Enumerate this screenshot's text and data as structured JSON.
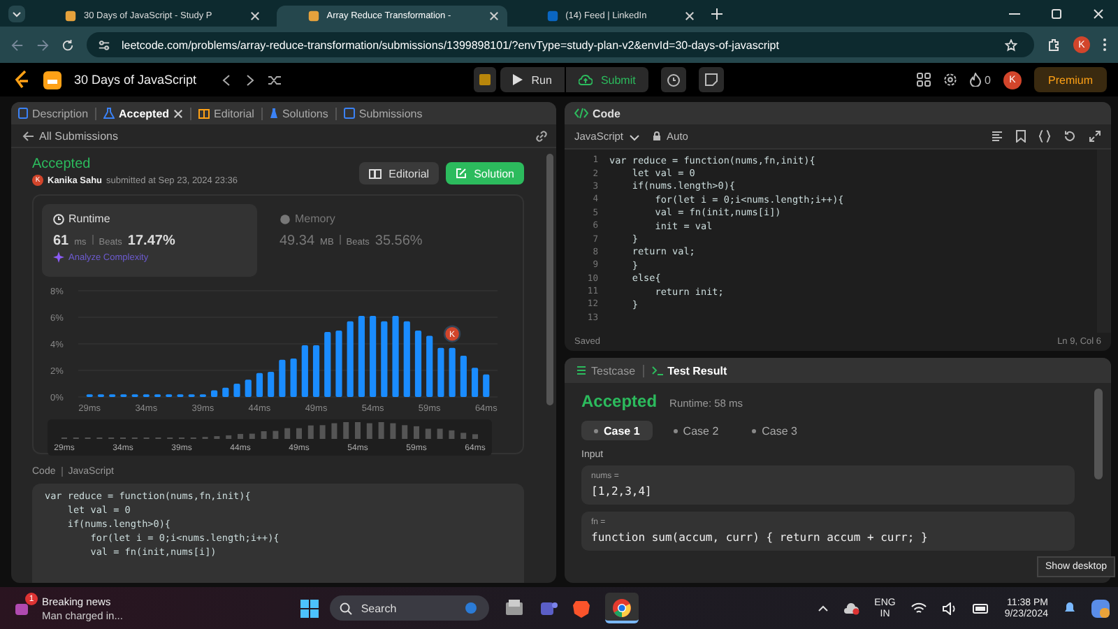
{
  "browser": {
    "tabs": [
      {
        "title": "30 Days of JavaScript - Study P",
        "selected": false
      },
      {
        "title": "Array Reduce Transformation - ",
        "selected": true
      },
      {
        "title": "(14) Feed | LinkedIn",
        "selected": false
      }
    ],
    "url": "leetcode.com/problems/array-reduce-transformation/submissions/1399898101/?envType=study-plan-v2&envId=30-days-of-javascript",
    "profile_initial": "K"
  },
  "nav": {
    "title": "30 Days of JavaScript",
    "run": "Run",
    "submit": "Submit",
    "streak": "0",
    "avatar_initial": "K",
    "premium": "Premium"
  },
  "left_panel": {
    "tabs": [
      {
        "label": "Description",
        "selected": false,
        "closable": false
      },
      {
        "label": "Accepted",
        "selected": true,
        "closable": true
      },
      {
        "label": "Editorial",
        "selected": false,
        "closable": false
      },
      {
        "label": "Solutions",
        "selected": false,
        "closable": false
      },
      {
        "label": "Submissions",
        "selected": false,
        "closable": false
      }
    ],
    "back_link": "All Submissions",
    "status": "Accepted",
    "author_initial": "K",
    "author": "Kanika Sahu",
    "submitted": "submitted at Sep 23, 2024 23:36",
    "buttons": [
      {
        "label": "Editorial",
        "kind": "secondary"
      },
      {
        "label": "Solution",
        "kind": "primary"
      }
    ],
    "stats": [
      {
        "kind": "runtime",
        "label": "Runtime",
        "value": "61",
        "unit": "ms",
        "beats_label": "Beats",
        "beats": "17.47%",
        "selected": true
      },
      {
        "kind": "memory",
        "label": "Memory",
        "value": "49.34",
        "unit": "MB",
        "beats_label": "Beats",
        "beats": "35.56%",
        "selected": false
      }
    ],
    "analyze_link": "Analyze Complexity",
    "chart_data": {
      "type": "bar",
      "x": [
        29,
        30,
        31,
        32,
        33,
        34,
        35,
        36,
        37,
        38,
        39,
        40,
        41,
        42,
        43,
        44,
        45,
        46,
        47,
        48,
        49,
        50,
        51,
        52,
        53,
        54,
        55,
        56,
        57,
        58,
        59,
        60,
        61,
        62,
        63,
        64
      ],
      "series": [
        {
          "color": "#1a8cff",
          "values": [
            0.2,
            0.2,
            0.2,
            0.2,
            0.2,
            0.2,
            0.2,
            0.2,
            0.2,
            0.2,
            0.2,
            0.5,
            0.7,
            1.0,
            1.3,
            1.8,
            1.9,
            2.8,
            2.9,
            3.9,
            3.9,
            4.9,
            5.0,
            5.7,
            6.1,
            6.1,
            5.7,
            6.1,
            5.7,
            5.0,
            4.6,
            3.7,
            3.7,
            3.1,
            2.2,
            1.7
          ]
        }
      ],
      "xlim": [
        28,
        65
      ],
      "ylim": [
        0,
        8
      ],
      "grid": true,
      "xticks": [
        {
          "value": 29,
          "label": "29ms"
        },
        {
          "value": 34,
          "label": "34ms"
        },
        {
          "value": 39,
          "label": "39ms"
        },
        {
          "value": 44,
          "label": "44ms"
        },
        {
          "value": 49,
          "label": "49ms"
        },
        {
          "value": 54,
          "label": "54ms"
        },
        {
          "value": 59,
          "label": "59ms"
        },
        {
          "value": 64,
          "label": "64ms"
        }
      ],
      "yticks": [
        {
          "value": 0,
          "label": "0%"
        },
        {
          "value": 2,
          "label": "2%"
        },
        {
          "value": 4,
          "label": "4%"
        },
        {
          "value": 6,
          "label": "6%"
        },
        {
          "value": 8,
          "label": "8%"
        }
      ],
      "annotations": [
        {
          "x": 61,
          "text": "K"
        }
      ]
    },
    "overview_labels": [
      "29ms",
      "34ms",
      "39ms",
      "44ms",
      "49ms",
      "54ms",
      "59ms",
      "64ms"
    ],
    "code_label": "Code",
    "code_language": "JavaScript",
    "code_lines": [
      "var reduce = function(nums,fn,init){",
      "    let val = 0",
      "    if(nums.length>0){",
      "        for(let i = 0;i<nums.length;i++){",
      "        val = fn(init,nums[i])"
    ]
  },
  "editor": {
    "title": "Code",
    "language": "JavaScript",
    "mode": "Auto",
    "lines": [
      {
        "number": "1",
        "code": "var reduce = function(nums,fn,init){"
      },
      {
        "number": "2",
        "code": "    let val = 0"
      },
      {
        "number": "3",
        "code": "    if(nums.length>0){"
      },
      {
        "number": "4",
        "code": "        for(let i = 0;i<nums.length;i++){"
      },
      {
        "number": "5",
        "code": "        val = fn(init,nums[i])"
      },
      {
        "number": "6",
        "code": "        init = val"
      },
      {
        "number": "7",
        "code": "    }"
      },
      {
        "number": "8",
        "code": "    return val;"
      },
      {
        "number": "9",
        "code": "    }"
      },
      {
        "number": "10",
        "code": "    else{"
      },
      {
        "number": "11",
        "code": "        return init;"
      },
      {
        "number": "12",
        "code": "    }"
      },
      {
        "number": "13"
      }
    ],
    "status": "Saved",
    "cursor": "Ln 9, Col 6"
  },
  "results": {
    "tabs": [
      {
        "label": "Testcase",
        "selected": false
      },
      {
        "label": "Test Result",
        "selected": true
      }
    ],
    "verdict": "Accepted",
    "runtime": "Runtime: 58 ms",
    "cases": [
      {
        "label": "Case 1",
        "selected": true
      },
      {
        "label": "Case 2",
        "selected": false
      },
      {
        "label": "Case 3",
        "selected": false
      }
    ],
    "input_label": "Input",
    "inputs": [
      {
        "name": "nums =",
        "value": "[1,2,3,4]"
      },
      {
        "name": "fn =",
        "value": "function sum(accum, curr) { return accum + curr; }"
      }
    ]
  },
  "taskbar": {
    "news_badge": "1",
    "news_title": "Breaking news",
    "news_text": "Man charged in...",
    "search": "Search",
    "language": "ENG",
    "region": "IN",
    "time": "11:38 PM",
    "date": "9/23/2024",
    "tooltip": "Show desktop"
  }
}
